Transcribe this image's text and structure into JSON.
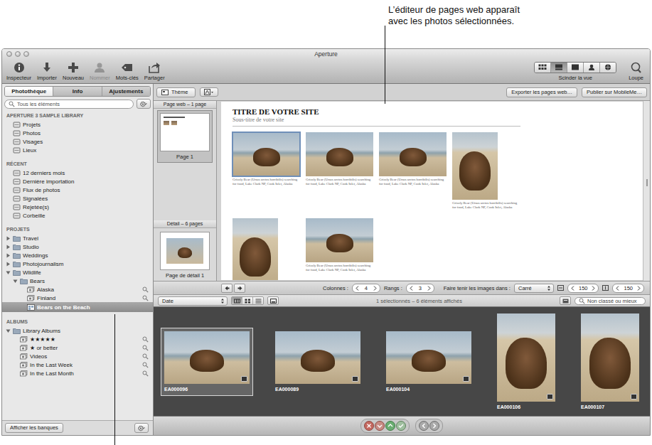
{
  "callout": {
    "lines": [
      "L’éditeur de pages web apparaît",
      "avec les photos sélectionnées."
    ]
  },
  "window": {
    "title": "Aperture"
  },
  "toolbar": {
    "buttons": [
      {
        "label": "Inspecteur",
        "disabled": false
      },
      {
        "label": "Importer",
        "disabled": false
      },
      {
        "label": "Nouveau",
        "disabled": false
      },
      {
        "label": "Nommer",
        "disabled": true
      },
      {
        "label": "Mots-clés",
        "disabled": false
      },
      {
        "label": "Partager",
        "disabled": false
      }
    ],
    "views": [
      {
        "selected": false
      },
      {
        "selected": true
      },
      {
        "selected": false
      },
      {
        "selected": false
      },
      {
        "selected": false
      }
    ],
    "views_label": "Scinder la vue",
    "loupe": "Loupe"
  },
  "sidebar": {
    "tabs": [
      {
        "label": "Photothèque",
        "selected": true
      },
      {
        "label": "Info",
        "selected": false
      },
      {
        "label": "Ajustements",
        "selected": false
      }
    ],
    "search": {
      "placeholder": "Tous les éléments"
    },
    "sections": [
      {
        "title": "APERTURE 3 SAMPLE LIBRARY",
        "items": [
          {
            "label": "Projets",
            "kind": "nav",
            "selected": false
          },
          {
            "label": "Photos",
            "kind": "nav",
            "selected": false
          },
          {
            "label": "Visages",
            "kind": "nav",
            "selected": false
          },
          {
            "label": "Lieux",
            "kind": "nav",
            "selected": false
          }
        ]
      },
      {
        "title": "RÉCENT",
        "items": [
          {
            "label": "12 derniers mois",
            "kind": "nav",
            "selected": false
          },
          {
            "label": "Dernière importation",
            "kind": "nav",
            "selected": false
          },
          {
            "label": "Flux de photos",
            "kind": "nav",
            "selected": false
          },
          {
            "label": "Signalées",
            "kind": "nav",
            "selected": false
          },
          {
            "label": "Rejetée(s)",
            "kind": "nav",
            "selected": false
          },
          {
            "label": "Corbeille",
            "kind": "nav",
            "selected": false
          }
        ]
      },
      {
        "title": "PROJETS",
        "items": [
          {
            "label": "Travel",
            "kind": "folder",
            "expanded": false,
            "selected": false
          },
          {
            "label": "Studio",
            "kind": "folder",
            "expanded": false,
            "selected": false
          },
          {
            "label": "Weddings",
            "kind": "folder",
            "expanded": false,
            "selected": false
          },
          {
            "label": "Photojournalism",
            "kind": "folder",
            "expanded": false,
            "selected": false
          },
          {
            "label": "Wildlife",
            "kind": "folder",
            "expanded": true,
            "selected": false,
            "children": [
              {
                "label": "Bears",
                "kind": "folder",
                "expanded": true,
                "selected": false,
                "children": [
                  {
                    "label": "Alaska",
                    "kind": "smart-album",
                    "selected": false
                  },
                  {
                    "label": "Finland",
                    "kind": "smart-album",
                    "selected": false
                  },
                  {
                    "label": "Bears on the Beach",
                    "kind": "webpage",
                    "selected": true
                  }
                ]
              }
            ]
          }
        ]
      },
      {
        "title": "ALBUMS",
        "items": [
          {
            "label": "Library Albums",
            "kind": "folder",
            "expanded": true,
            "selected": false,
            "children": [
              {
                "label": "★★★★★",
                "kind": "smart-album",
                "selected": false
              },
              {
                "label": "★ or better",
                "kind": "smart-album",
                "selected": false
              },
              {
                "label": "Videos",
                "kind": "smart-album",
                "selected": false
              },
              {
                "label": "In the Last Week",
                "kind": "smart-album",
                "selected": false
              },
              {
                "label": "In the Last Month",
                "kind": "smart-album",
                "selected": false
              }
            ]
          }
        ]
      }
    ],
    "footer_button": "Afficher les banques"
  },
  "topbar": {
    "theme": "Thème",
    "actions": [
      "Exporter les pages web…",
      "Publier sur MobileMe…"
    ]
  },
  "pages": [
    {
      "title": "Page web – 1 page",
      "thumb": {
        "label": "Page 1",
        "selected": true
      }
    },
    {
      "title": "Détail – 6 pages",
      "thumb": {
        "label": "Page de détail 1",
        "selected": false
      }
    }
  ],
  "webpage": {
    "title": "TITRE DE VOTRE SITE",
    "subtitle": "Sous-titre de votre site",
    "photos": [
      {
        "kind": "landscape",
        "selected": true,
        "caption": "Grizzly Bear (Ursus arctos horribilis) searching for food, Lake Clark NP, Cook Inlet, Alaska"
      },
      {
        "kind": "landscape",
        "selected": false,
        "caption": "Grizzly Bear (Ursus arctos horribilis) searching for food, Lake Clark NP, Cook Inlet, Alaska"
      },
      {
        "kind": "landscape",
        "selected": false,
        "caption": "Grizzly Bear (Ursus arctos horribilis) searching for food, Lake Clark NP, Cook Inlet, Alaska"
      },
      {
        "kind": "portrait",
        "selected": false,
        "caption": "Grizzly Bear (Ursus arctos horribilis) searching for food, Lake Clark NP, Cook Inlet, Alaska"
      },
      {
        "kind": "portrait",
        "selected": false
      },
      {
        "kind": "landscape",
        "selected": false,
        "caption": "Grizzly Bear (Ursus arctos horribilis) searching for food, Lake Clark NP, Cook Inlet, Alaska"
      }
    ]
  },
  "layout_controls": {
    "columns_label": "Colonnes :",
    "columns": "4",
    "rows_label": "Rangs :",
    "rows": "3",
    "fit_label": "Faire tenir les images dans :",
    "fit": "Carré",
    "width": "150",
    "height": "150"
  },
  "browser_bar": {
    "sort": "Date",
    "views": [
      {
        "selected": true
      },
      {
        "selected": false
      },
      {
        "selected": false
      }
    ],
    "status": "1 sélectionnés – 6 éléments affichés",
    "filter": "Non classé ou mieux"
  },
  "thumbnails": [
    {
      "label": "EA000096",
      "kind": "landscape",
      "selected": true
    },
    {
      "label": "EA000089",
      "kind": "landscape",
      "selected": false
    },
    {
      "label": "EA000104",
      "kind": "landscape",
      "selected": false
    },
    {
      "label": "EA000106",
      "kind": "portrait",
      "selected": false
    },
    {
      "label": "EA000107",
      "kind": "portrait",
      "selected": false
    }
  ]
}
